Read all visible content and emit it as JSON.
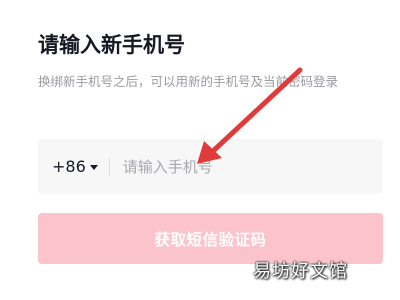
{
  "header": {
    "title": "请输入新手机号",
    "description": "换绑新手机号之后，可以用新的手机号及当前密码登录"
  },
  "phone": {
    "country_code": "+86",
    "placeholder": "请输入手机号"
  },
  "actions": {
    "get_code_label": "获取短信验证码"
  },
  "watermark": "易坊好文馆",
  "colors": {
    "button_disabled": "#fbc3cb",
    "arrow": "#e03a3a",
    "placeholder": "#a8a9ae"
  }
}
